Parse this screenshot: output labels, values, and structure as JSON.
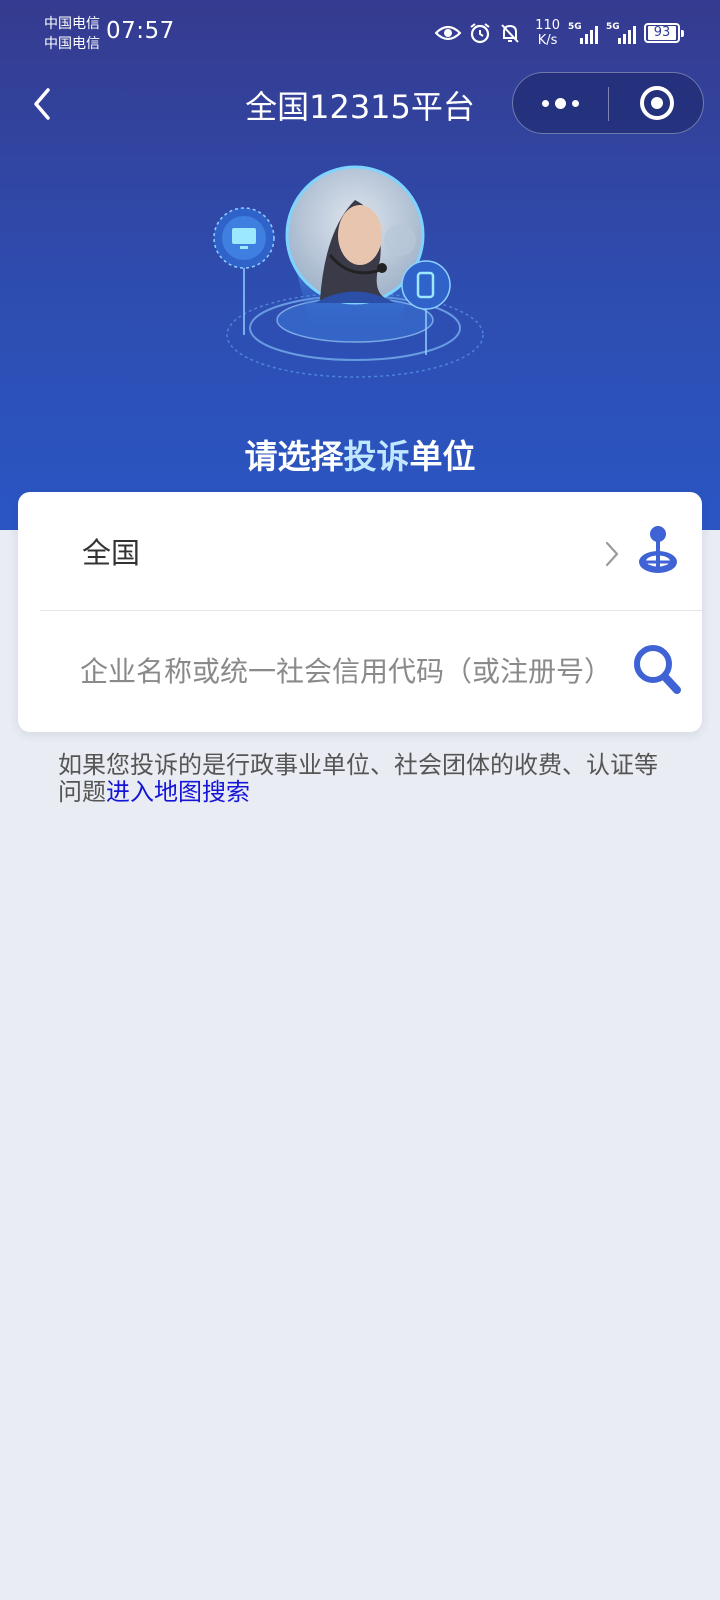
{
  "status_bar": {
    "carrier_1": "中国电信",
    "carrier_2": "中国电信",
    "time": "07:57",
    "speed_value": "110",
    "speed_unit": "K/s",
    "sig1_tag": "5G",
    "sig2_tag": "5G",
    "battery": "93"
  },
  "nav": {
    "title": "全国12315平台"
  },
  "hero": {
    "title_part1": "请选择",
    "title_highlight": "投诉",
    "title_part2": "单位"
  },
  "form": {
    "region_value": "全国",
    "search_placeholder": "企业名称或统一社会信用代码（或注册号）"
  },
  "hint": {
    "text": "如果您投诉的是行政事业单位、社会团体的收费、认证等问题",
    "link": "进入地图搜索"
  },
  "colors": {
    "header_top": "#353b8f",
    "header_bottom": "#2a56c4",
    "accent_icon": "#3f62d4",
    "link": "#1515d8",
    "highlight": "#bfe7ff"
  }
}
